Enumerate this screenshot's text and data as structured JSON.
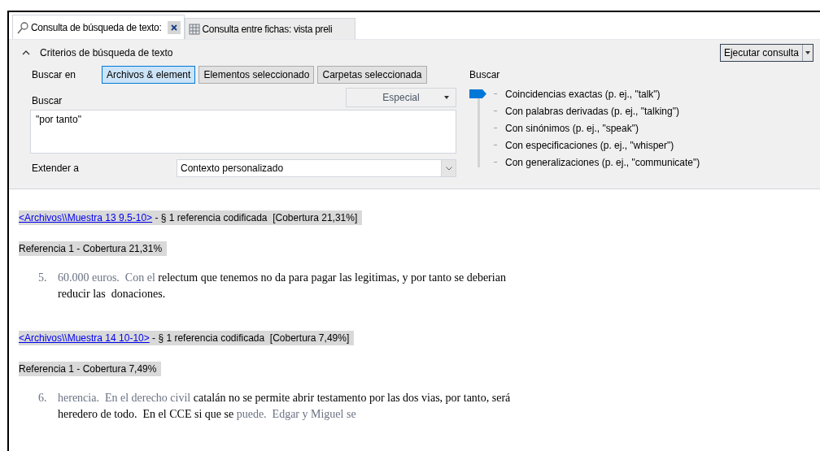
{
  "tabs": [
    {
      "label": "Consulta de búsqueda de texto:",
      "kind": "search",
      "selected": true,
      "closable": true
    },
    {
      "label": "Consulta entre fichas: vista preli",
      "kind": "grid",
      "selected": false,
      "closable": false
    }
  ],
  "criteria": {
    "title": "Criterios de búsqueda de texto",
    "expanded": true,
    "run_button": "Ejecutar consulta",
    "search_in": {
      "label": "Buscar en",
      "options": [
        {
          "label": "Archivos & element",
          "selected": true
        },
        {
          "label": "Elementos seleccionado",
          "selected": false
        },
        {
          "label": "Carpetas seleccionada",
          "selected": false
        }
      ]
    },
    "search": {
      "label": "Buscar",
      "special": "Especial",
      "value": "\"por tanto\""
    },
    "extend": {
      "label": "Extender a",
      "value": "Contexto personalizado"
    },
    "match": {
      "label": "Buscar",
      "options": [
        {
          "label": "Coincidencias exactas (p. ej., \"talk\")",
          "selected": true
        },
        {
          "label": "Con palabras derivadas (p. ej., \"talking\")",
          "selected": false
        },
        {
          "label": "Con sinónimos (p. ej., \"speak\")",
          "selected": false
        },
        {
          "label": "Con especificaciones (p. ej., \"whisper\")",
          "selected": false
        },
        {
          "label": "Con generalizaciones (p. ej., \"communicate\")",
          "selected": false
        }
      ]
    }
  },
  "results": [
    {
      "link": "<Archivos\\\\Muestra 13 9.5-10>",
      "summary": " - § 1 referencia codificada  [Cobertura 21,31%]",
      "reference": "Referencia 1 - Cobertura 21,31%",
      "number": "5.",
      "segments": [
        {
          "text": "60.000 euros.  Con el ",
          "kind": "context"
        },
        {
          "text": "relectum que tenemos no da para pagar las legitimas, y por tanto se deberian reducir las  donaciones.",
          "kind": "match"
        }
      ]
    },
    {
      "link": "<Archivos\\\\Muestra 14 10-10>",
      "summary": " - § 1 referencia codificada  [Cobertura 7,49%]",
      "reference": "Referencia 1 - Cobertura 7,49%",
      "number": "6.",
      "segments": [
        {
          "text": "herencia.  En el derecho civil ",
          "kind": "context"
        },
        {
          "text": "catalán no se permite abrir testamento por las dos vias, por tanto, será heredero de todo.  En el CCE si que se ",
          "kind": "match"
        },
        {
          "text": "puede.  Edgar y Miguel se",
          "kind": "context"
        }
      ]
    }
  ]
}
